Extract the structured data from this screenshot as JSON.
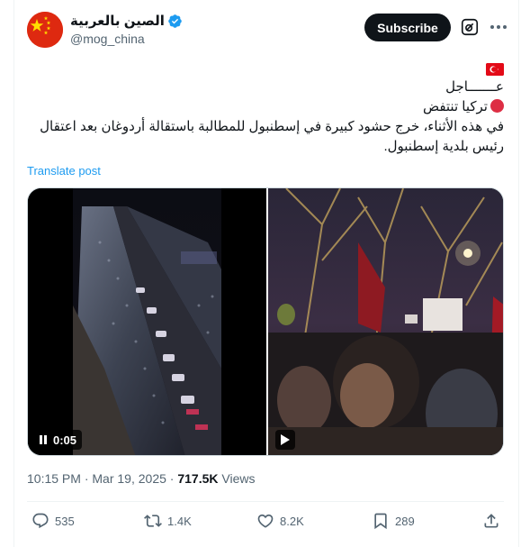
{
  "author": {
    "display_name": "الصين بالعربية",
    "handle": "@mog_china"
  },
  "header": {
    "subscribe_label": "Subscribe"
  },
  "tweet": {
    "line_breaking": "عـــــــاجل",
    "line_headline": "تركيا تنتفض",
    "line_body": "في هذه الأثناء، خرج حشود كبيرة في إسطنبول للمطالبة باستقالة أردوغان بعد اعتقال رئيس بلدية إسطنبول.",
    "translate_label": "Translate post"
  },
  "media": {
    "left_video_duration": "0:05"
  },
  "meta": {
    "time": "10:15 PM",
    "separator": " · ",
    "date": "Mar 19, 2025",
    "views_count": "717.5K",
    "views_label": " Views"
  },
  "actions": {
    "replies": "535",
    "reposts": "1.4K",
    "likes": "8.2K",
    "bookmarks": "289"
  },
  "icons": {
    "avatar": "china-flag-avatar",
    "verified": "verified-badge-icon",
    "grok": "grok-icon",
    "more": "more-icon",
    "reply": "reply-icon",
    "repost": "repost-icon",
    "like": "like-icon",
    "bookmark": "bookmark-icon",
    "share": "share-icon"
  },
  "colors": {
    "accent": "#1d9bf0",
    "text_primary": "#0f1419",
    "text_secondary": "#536471",
    "china_red": "#de2910",
    "turkey_red": "#e30a17"
  }
}
